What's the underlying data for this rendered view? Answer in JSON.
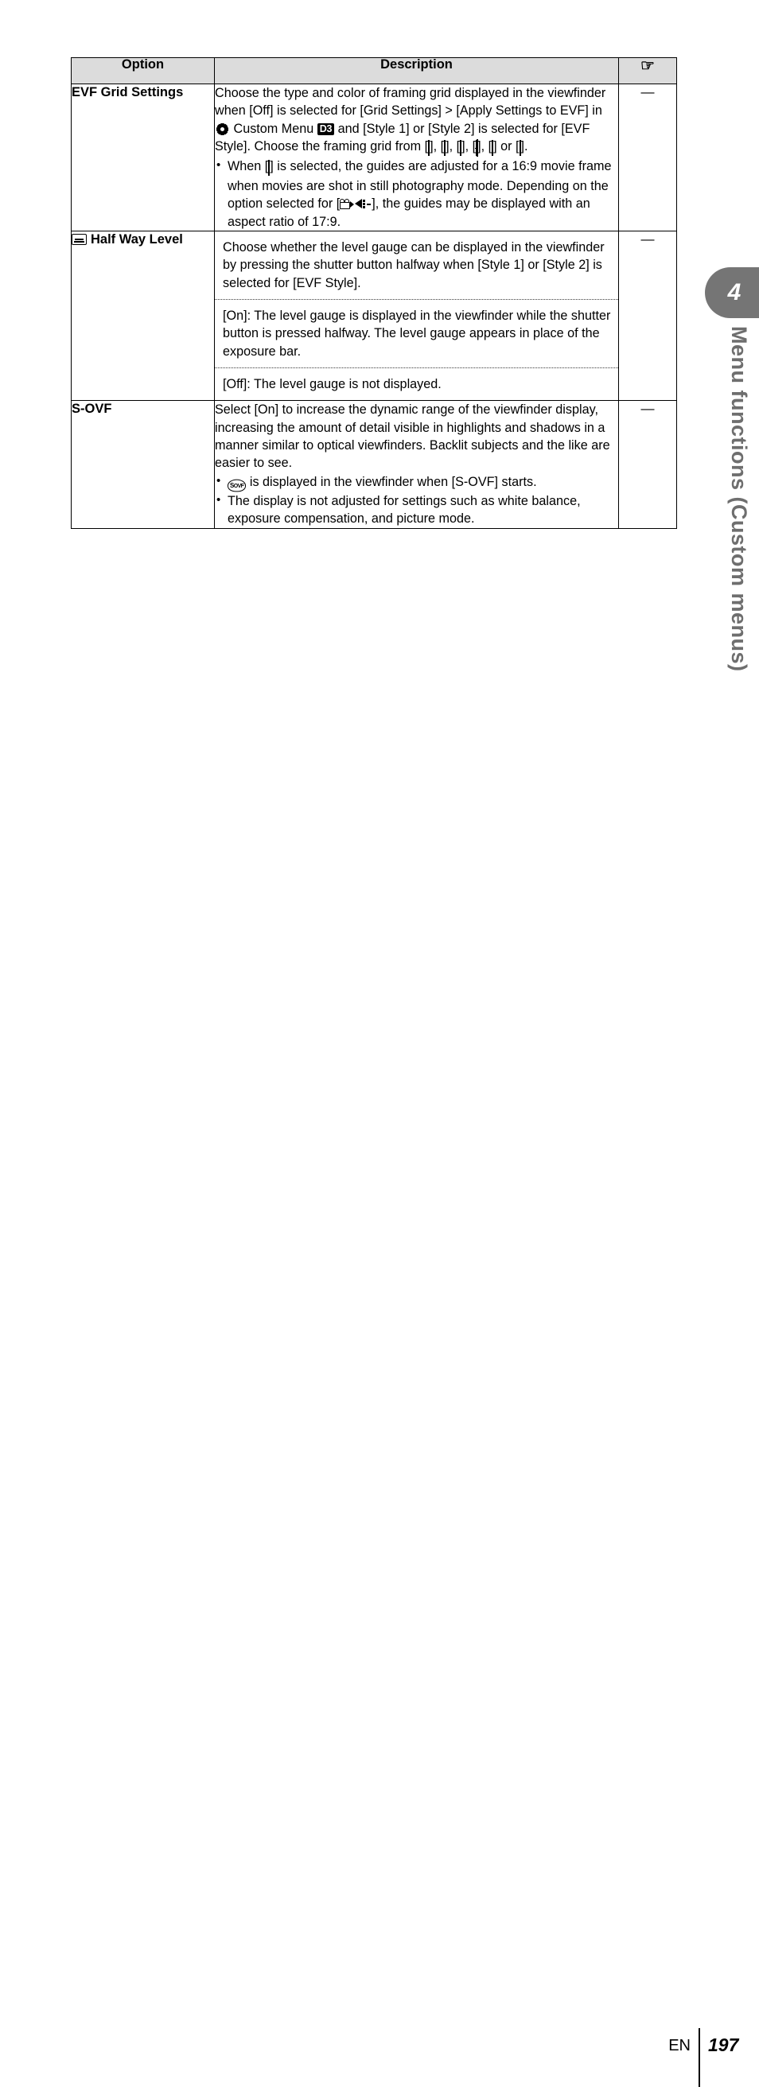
{
  "page": {
    "language_code": "EN",
    "page_number": "197",
    "chapter_number": "4",
    "chapter_title": "Menu functions (Custom menus)"
  },
  "table": {
    "headers": {
      "option": "Option",
      "description": "Description",
      "reference_icon": "pointing-hand-icon"
    },
    "rows": [
      {
        "option_label": "EVF Grid Settings",
        "option_icon": null,
        "reference": "—",
        "description_blocks": [
          {
            "type": "paragraph",
            "segments": [
              {
                "t": "text",
                "v": "Choose the type and color of framing grid displayed in the viewfinder when [Off] is selected for [Grid Settings] > [Apply Settings to EVF] in "
              },
              {
                "t": "icon",
                "v": "custom-menu-gear-icon"
              },
              {
                "t": "text",
                "v": " Custom Menu "
              },
              {
                "t": "badge",
                "v": "D3"
              },
              {
                "t": "text",
                "v": " and [Style 1] or [Style 2] is selected for [EVF Style]. Choose the framing grid from ["
              },
              {
                "t": "icon",
                "v": "grid-dense-icon"
              },
              {
                "t": "text",
                "v": "], ["
              },
              {
                "t": "icon",
                "v": "grid-3x3-icon"
              },
              {
                "t": "text",
                "v": "], ["
              },
              {
                "t": "icon",
                "v": "grid-thirds-icon"
              },
              {
                "t": "text",
                "v": "], ["
              },
              {
                "t": "icon",
                "v": "grid-crosshair-icon"
              },
              {
                "t": "text",
                "v": "], ["
              },
              {
                "t": "icon",
                "v": "grid-diagonal-icon"
              },
              {
                "t": "text",
                "v": "] or ["
              },
              {
                "t": "icon",
                "v": "grid-16x9-frame-icon"
              },
              {
                "t": "text",
                "v": "]."
              }
            ]
          },
          {
            "type": "bullet",
            "segments": [
              {
                "t": "text",
                "v": "When ["
              },
              {
                "t": "icon",
                "v": "grid-16x9-frame-icon"
              },
              {
                "t": "text",
                "v": "] is selected, the guides are adjusted for a 16:9 movie frame when movies are shot in still photography mode. Depending on the option selected for ["
              },
              {
                "t": "icon",
                "v": "movie-camera-icon"
              },
              {
                "t": "icon",
                "v": "movie-quality-icon"
              },
              {
                "t": "text",
                "v": "], the guides may be displayed with an aspect ratio of 17:9."
              }
            ]
          }
        ]
      },
      {
        "option_label": "Half Way Level",
        "option_icon": "level-gauge-icon",
        "reference": "—",
        "description_blocks": [
          {
            "type": "paragraph",
            "segments": [
              {
                "t": "text",
                "v": "Choose whether the level gauge can be displayed in the viewfinder by pressing the shutter button halfway when [Style 1] or [Style 2] is selected for [EVF Style]."
              }
            ]
          },
          {
            "type": "separator"
          },
          {
            "type": "paragraph",
            "segments": [
              {
                "t": "text",
                "v": "[On]: The level gauge is displayed in the viewfinder while the shutter button is pressed halfway. The level gauge appears in place of the exposure bar."
              }
            ]
          },
          {
            "type": "separator"
          },
          {
            "type": "paragraph",
            "segments": [
              {
                "t": "text",
                "v": "[Off]: The level gauge is not displayed."
              }
            ]
          }
        ]
      },
      {
        "option_label": "S-OVF",
        "option_icon": null,
        "reference": "—",
        "description_blocks": [
          {
            "type": "paragraph",
            "segments": [
              {
                "t": "text",
                "v": "Select [On] to increase the dynamic range of the viewfinder display, increasing the amount of detail visible in highlights and shadows in a manner similar to optical viewfinders. Backlit subjects and the like are easier to see."
              }
            ]
          },
          {
            "type": "bullet",
            "segments": [
              {
                "t": "icon",
                "v": "s-ovf-badge-icon"
              },
              {
                "t": "text",
                "v": " is displayed in the viewfinder when [S-OVF] starts."
              }
            ]
          },
          {
            "type": "bullet",
            "segments": [
              {
                "t": "text",
                "v": "The display is not adjusted for settings such as white balance, exposure compensation, and picture mode."
              }
            ]
          }
        ]
      }
    ]
  },
  "colors": {
    "header_fill": "#dcdcdc",
    "sidebar_tab": "#757575",
    "sidebar_text": "#6e6e6e",
    "border": "#000000"
  }
}
